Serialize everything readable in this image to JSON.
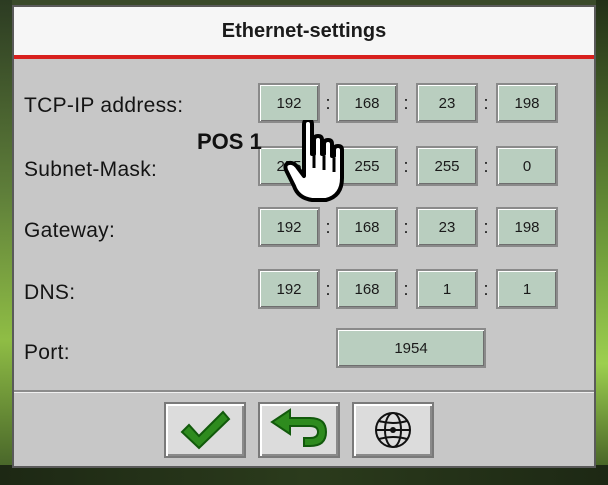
{
  "dialog": {
    "title": "Ethernet-settings"
  },
  "rows": {
    "tcpip": {
      "label": "TCP-IP address:",
      "octets": [
        "192",
        "168",
        "23",
        "198"
      ]
    },
    "subnet": {
      "label": "Subnet-Mask:",
      "octets": [
        "255",
        "255",
        "255",
        "0"
      ]
    },
    "gateway": {
      "label": "Gateway:",
      "octets": [
        "192",
        "168",
        "23",
        "198"
      ]
    },
    "dns": {
      "label": "DNS:",
      "octets": [
        "192",
        "168",
        "1",
        "1"
      ]
    },
    "port": {
      "label": "Port:",
      "value": "1954"
    }
  },
  "separator": ":",
  "annotation": {
    "text": "POS 1"
  },
  "buttons": {
    "confirm": {
      "icon": "checkmark-icon",
      "color": "#2e8b1e"
    },
    "back": {
      "icon": "return-arrow-icon",
      "color": "#2e8b1e"
    },
    "network": {
      "icon": "globe-icon"
    }
  },
  "colors": {
    "accent_line": "#d8201e",
    "field_bg": "#b9cebf",
    "dialog_bg": "#c7c7c7"
  }
}
